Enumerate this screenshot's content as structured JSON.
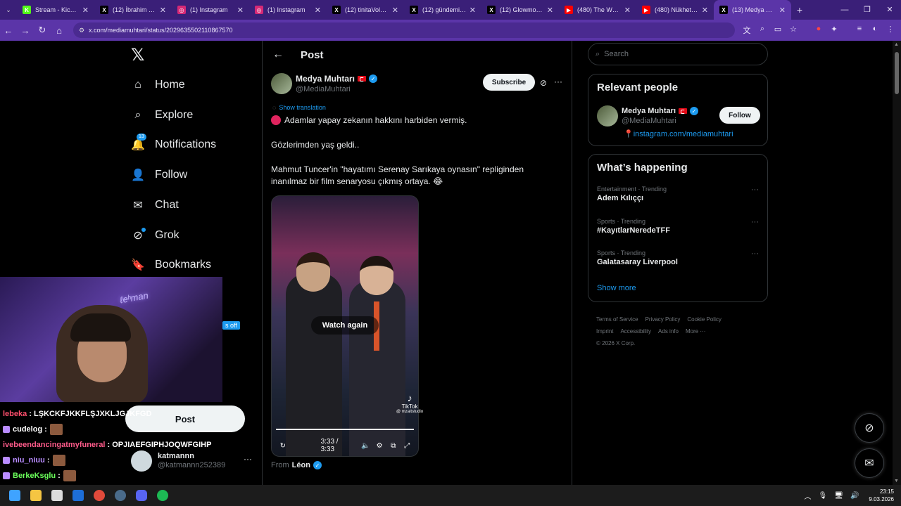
{
  "browser": {
    "tabs": [
      {
        "title": "Stream - Kick Dashboard",
        "fav": "K",
        "color": "#53fc18"
      },
      {
        "title": "(12) İbrahim on X",
        "fav": "X",
        "color": "#000000"
      },
      {
        "title": "(1) Instagram",
        "fav": "◎",
        "color": "#d62976"
      },
      {
        "title": "(1) Instagram",
        "fav": "◎",
        "color": "#d62976"
      },
      {
        "title": "(12) tinitaVolkan on X",
        "fav": "X",
        "color": "#000000"
      },
      {
        "title": "(12) gündemio on X",
        "fav": "X",
        "color": "#000000"
      },
      {
        "title": "(12) Glowmoon on X",
        "fav": "X",
        "color": "#000000"
      },
      {
        "title": "(480) The Weeknd",
        "fav": "▶",
        "color": "#ff0000"
      },
      {
        "title": "(480) Nükhet Duru",
        "fav": "▶",
        "color": "#ff0000"
      },
      {
        "title": "(13) Medya Muhtarı",
        "fav": "X",
        "color": "#000000"
      }
    ],
    "url": "x.com/mediamuhtari/status/2029635502110867570"
  },
  "nav": {
    "items": [
      {
        "label": "Home",
        "icon": "home-icon"
      },
      {
        "label": "Explore",
        "icon": "search-icon"
      },
      {
        "label": "Notifications",
        "icon": "bell-icon",
        "badge": "13"
      },
      {
        "label": "Follow",
        "icon": "person-plus-icon"
      },
      {
        "label": "Chat",
        "icon": "mail-icon"
      },
      {
        "label": "Grok",
        "icon": "grok-icon"
      },
      {
        "label": "Bookmarks",
        "icon": "bookmark-icon"
      }
    ],
    "post_label": "Post",
    "account": {
      "name": "katmannn",
      "handle": "@katmannn252389"
    }
  },
  "stream_overlay": {
    "off_badge": "s off",
    "chat": [
      {
        "user": "lebeka",
        "color": "#ff4f6d",
        "text": ": LŞKCKFJKKFLŞJXKLJGJKFGD"
      },
      {
        "user": "cudelog",
        "color": "#ffffff",
        "text": ":",
        "emote": true
      },
      {
        "user": "ivebeendancingatmyfuneral",
        "color": "#ff5b8a",
        "text": ": OPJIAEFGIPHJOQWFGIHP"
      },
      {
        "user": "niu_niuu",
        "color": "#b98cff",
        "text": ":",
        "emote": true
      },
      {
        "user": "BerkeKsglu",
        "color": "#6cff5b",
        "text": ":",
        "emote": true
      }
    ]
  },
  "post": {
    "header_title": "Post",
    "author": {
      "name": "Medya Muhtarı",
      "handle": "@MediaMuhtari"
    },
    "subscribe_label": "Subscribe",
    "show_translation": "Show translation",
    "line1": "Adamlar yapay zekanın hakkını harbiden vermiş.",
    "line2": "Gözlerimden yaş geldi..",
    "line3": "Mahmut Tuncer'in \"hayatımı Serenay Sarıkaya oynasın\" repliginden inanılmaz bir film senaryosu çıkmış ortaya. 😂",
    "video": {
      "watch_again": "Watch again",
      "time": "3:33 / 3:33",
      "watermark": "TikTok",
      "watermark_sub": "@ mzaitstudio",
      "progress": 1.0
    },
    "from_label": "From",
    "from_name": "Léon"
  },
  "sidebar": {
    "search_placeholder": "Search",
    "relevant": {
      "title": "Relevant people",
      "name": "Medya Muhtarı",
      "handle": "@MediaMuhtari",
      "follow_label": "Follow",
      "link": "📍instagram.com/mediamuhtari"
    },
    "happening": {
      "title": "What’s happening",
      "trends": [
        {
          "category": "Entertainment · Trending",
          "name": "Adem Kılıççı"
        },
        {
          "category": "Sports · Trending",
          "name": "#KayıtlarNeredeTFF"
        },
        {
          "category": "Sports · Trending",
          "name": "Galatasaray Liverpool"
        }
      ],
      "show_more": "Show more"
    },
    "footer": {
      "links": [
        "Terms of Service",
        "Privacy Policy",
        "Cookie Policy",
        "Imprint",
        "Accessibility",
        "Ads info",
        "More ···"
      ],
      "copyright": "© 2026 X Corp."
    }
  },
  "taskbar": {
    "time": "23:15",
    "date": "9.03.2026"
  }
}
